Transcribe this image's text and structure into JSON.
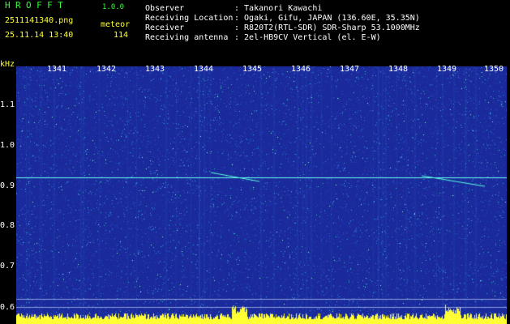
{
  "app": {
    "title": "HROFFT",
    "version": "1.0.0",
    "filename": "2511141340.png",
    "datetime": "25.11.14 13:40",
    "meteor_label": "meteor",
    "meteor_count": "114"
  },
  "info": [
    {
      "label": "Observer",
      "value": ": Takanori Kawachi"
    },
    {
      "label": "Receiving Location",
      "value": ": Ogaki, Gifu, JAPAN (136.60E, 35.35N)"
    },
    {
      "label": "Receiver",
      "value": ": R820T2(RTL-SDR) SDR-Sharp 53.1000MHz"
    },
    {
      "label": "Receiving antenna",
      "value": ": 2el-HB9CV Vertical (el. E-W)"
    }
  ],
  "axis": {
    "y_unit": "kHz",
    "time_ticks": [
      "1341",
      "1342",
      "1343",
      "1344",
      "1345",
      "1346",
      "1347",
      "1348",
      "1349",
      "1350"
    ],
    "freq_ticks": [
      "1.1",
      "1.0",
      "0.9",
      "0.8",
      "0.7",
      "0.6"
    ]
  },
  "colors": {
    "background": "#000000",
    "spectrogram_base": "#1a2a9a",
    "carrier": "#66ffee",
    "noise": "#ffff33",
    "title": "#33ff33",
    "meta": "#ffff33"
  }
}
